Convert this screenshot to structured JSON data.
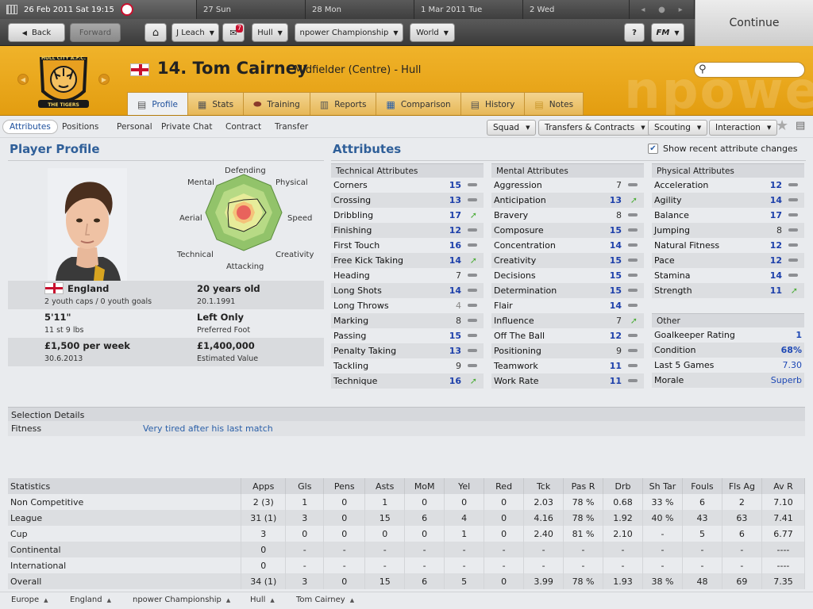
{
  "datebar": {
    "current": "26 Feb 2011 Sat 19:15",
    "days": [
      "27 Sun",
      "28 Mon",
      "1 Mar 2011 Tue",
      "2 Wed"
    ]
  },
  "nav": {
    "back": "Back",
    "forward": "Forward",
    "manager": "J Leach",
    "inbox_count": "7",
    "club": "Hull",
    "competition": "npower Championship",
    "world": "World",
    "help": "?",
    "fm": "FM",
    "continue": "Continue"
  },
  "header": {
    "number_name": "14. Tom Cairney",
    "position": "Midfielder (Centre) - Hull",
    "search_placeholder": "",
    "crest_text": "HULL CITY A.F.C.",
    "crest_banner": "THE TIGERS",
    "watermark": "npowe"
  },
  "tabs": [
    {
      "label": "Profile",
      "icon": "profile-icon",
      "active": true
    },
    {
      "label": "Stats",
      "icon": "stats-icon"
    },
    {
      "label": "Training",
      "icon": "training-icon"
    },
    {
      "label": "Reports",
      "icon": "reports-icon"
    },
    {
      "label": "Comparison",
      "icon": "comparison-icon"
    },
    {
      "label": "History",
      "icon": "history-icon"
    },
    {
      "label": "Notes",
      "icon": "notes-icon"
    }
  ],
  "subnav": {
    "items": [
      "Attributes",
      "Positions",
      "Personal",
      "Private Chat",
      "Contract",
      "Transfer"
    ],
    "menus": [
      "Squad",
      "Transfers & Contracts",
      "Scouting",
      "Interaction"
    ]
  },
  "profile": {
    "title": "Player Profile",
    "radar_labels": {
      "defending": "Defending",
      "physical": "Physical",
      "speed": "Speed",
      "creativity": "Creativity",
      "attacking": "Attacking",
      "technical": "Technical",
      "aerial": "Aerial",
      "mental": "Mental"
    },
    "nation": "England",
    "caps": "2 youth caps / 0 youth goals",
    "age": "20 years old",
    "dob": "20.1.1991",
    "height": "5'11\"",
    "weight": "11 st 9 lbs",
    "foot": "Left Only",
    "foot_label": "Preferred Foot",
    "wage": "£1,500 per week",
    "contract_end": "30.6.2013",
    "value": "£1,400,000",
    "value_label": "Estimated Value"
  },
  "attributes": {
    "title": "Attributes",
    "show_recent": "Show recent attribute changes",
    "technical_title": "Technical Attributes",
    "technical": [
      {
        "name": "Corners",
        "value": "15",
        "trend": "flat"
      },
      {
        "name": "Crossing",
        "value": "13",
        "trend": "flat"
      },
      {
        "name": "Dribbling",
        "value": "17",
        "trend": "up"
      },
      {
        "name": "Finishing",
        "value": "12",
        "trend": "flat"
      },
      {
        "name": "First Touch",
        "value": "16",
        "trend": "flat"
      },
      {
        "name": "Free Kick Taking",
        "value": "14",
        "trend": "up"
      },
      {
        "name": "Heading",
        "value": "7",
        "trend": "flat",
        "style": "g"
      },
      {
        "name": "Long Shots",
        "value": "14",
        "trend": "flat"
      },
      {
        "name": "Long Throws",
        "value": "4",
        "trend": "flat",
        "style": "dg"
      },
      {
        "name": "Marking",
        "value": "8",
        "trend": "flat",
        "style": "g"
      },
      {
        "name": "Passing",
        "value": "15",
        "trend": "flat"
      },
      {
        "name": "Penalty Taking",
        "value": "13",
        "trend": "flat"
      },
      {
        "name": "Tackling",
        "value": "9",
        "trend": "flat",
        "style": "g"
      },
      {
        "name": "Technique",
        "value": "16",
        "trend": "up"
      }
    ],
    "mental_title": "Mental Attributes",
    "mental": [
      {
        "name": "Aggression",
        "value": "7",
        "trend": "flat",
        "style": "g"
      },
      {
        "name": "Anticipation",
        "value": "13",
        "trend": "up"
      },
      {
        "name": "Bravery",
        "value": "8",
        "trend": "flat",
        "style": "g"
      },
      {
        "name": "Composure",
        "value": "15",
        "trend": "flat"
      },
      {
        "name": "Concentration",
        "value": "14",
        "trend": "flat"
      },
      {
        "name": "Creativity",
        "value": "15",
        "trend": "flat"
      },
      {
        "name": "Decisions",
        "value": "15",
        "trend": "flat"
      },
      {
        "name": "Determination",
        "value": "15",
        "trend": "flat"
      },
      {
        "name": "Flair",
        "value": "14",
        "trend": "flat"
      },
      {
        "name": "Influence",
        "value": "7",
        "trend": "up",
        "style": "g"
      },
      {
        "name": "Off The Ball",
        "value": "12",
        "trend": "flat"
      },
      {
        "name": "Positioning",
        "value": "9",
        "trend": "flat",
        "style": "g"
      },
      {
        "name": "Teamwork",
        "value": "11",
        "trend": "flat"
      },
      {
        "name": "Work Rate",
        "value": "11",
        "trend": "flat"
      }
    ],
    "physical_title": "Physical Attributes",
    "physical": [
      {
        "name": "Acceleration",
        "value": "12",
        "trend": "flat"
      },
      {
        "name": "Agility",
        "value": "14",
        "trend": "flat"
      },
      {
        "name": "Balance",
        "value": "17",
        "trend": "flat"
      },
      {
        "name": "Jumping",
        "value": "8",
        "trend": "flat",
        "style": "g"
      },
      {
        "name": "Natural Fitness",
        "value": "12",
        "trend": "flat"
      },
      {
        "name": "Pace",
        "value": "12",
        "trend": "flat"
      },
      {
        "name": "Stamina",
        "value": "14",
        "trend": "flat"
      },
      {
        "name": "Strength",
        "value": "11",
        "trend": "up"
      }
    ],
    "other_title": "Other",
    "other": [
      {
        "name": "Goalkeeper Rating",
        "value": "1",
        "bold": true
      },
      {
        "name": "Condition",
        "value": "68%",
        "bold": true
      },
      {
        "name": "Last 5 Games",
        "value": "7.30"
      },
      {
        "name": "Morale",
        "value": "Superb"
      }
    ]
  },
  "selection": {
    "title": "Selection Details",
    "label": "Fitness",
    "value": "Very tired after his last match"
  },
  "stats": {
    "headers": [
      "Statistics",
      "Apps",
      "Gls",
      "Pens",
      "Asts",
      "MoM",
      "Yel",
      "Red",
      "Tck",
      "Pas R",
      "Drb",
      "Sh Tar",
      "Fouls",
      "Fls Ag",
      "Av R"
    ],
    "rows": [
      [
        "Non Competitive",
        "2 (3)",
        "1",
        "0",
        "1",
        "0",
        "0",
        "0",
        "2.03",
        "78 %",
        "0.68",
        "33 %",
        "6",
        "2",
        "7.10"
      ],
      [
        "League",
        "31 (1)",
        "3",
        "0",
        "15",
        "6",
        "4",
        "0",
        "4.16",
        "78 %",
        "1.92",
        "40 %",
        "43",
        "63",
        "7.41"
      ],
      [
        "Cup",
        "3",
        "0",
        "0",
        "0",
        "0",
        "1",
        "0",
        "2.40",
        "81 %",
        "2.10",
        "-",
        "5",
        "6",
        "6.77"
      ],
      [
        "Continental",
        "0",
        "-",
        "-",
        "-",
        "-",
        "-",
        "-",
        "-",
        "-",
        "-",
        "-",
        "-",
        "-",
        "----"
      ],
      [
        "International",
        "0",
        "-",
        "-",
        "-",
        "-",
        "-",
        "-",
        "-",
        "-",
        "-",
        "-",
        "-",
        "-",
        "----"
      ],
      [
        "Overall",
        "34 (1)",
        "3",
        "0",
        "15",
        "6",
        "5",
        "0",
        "3.99",
        "78 %",
        "1.93",
        "38 %",
        "48",
        "69",
        "7.35"
      ]
    ]
  },
  "footer": [
    "Europe",
    "England",
    "npower Championship",
    "Hull",
    "Tom Cairney"
  ]
}
